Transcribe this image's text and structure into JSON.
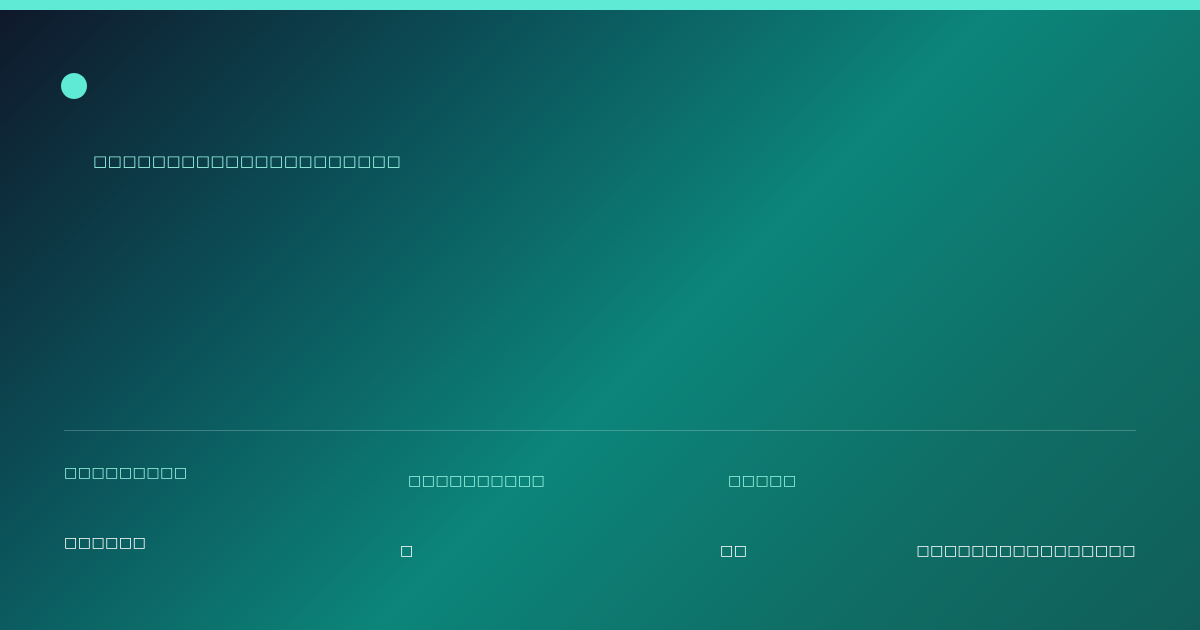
{
  "header": {
    "subtitle": "□□□□□□□□□□□□□□□□□□□□□"
  },
  "stats": [
    {
      "label": "□□□□□□□□□",
      "value": "□□□□□□"
    },
    {
      "label": "□□□□□□□□□□",
      "value": "□"
    },
    {
      "label": "□□□□□",
      "value": "□□"
    },
    {
      "label": "",
      "value": "□□□□□□□□□□□□□□□□"
    }
  ],
  "colors": {
    "accent": "#5eead4",
    "label": "#99f6e4",
    "value": "#ffffff",
    "gradient_start": "#0f172a",
    "gradient_mid": "#0c857a",
    "gradient_end": "#115e59"
  },
  "icons": [
    "accent-dot-icon"
  ]
}
